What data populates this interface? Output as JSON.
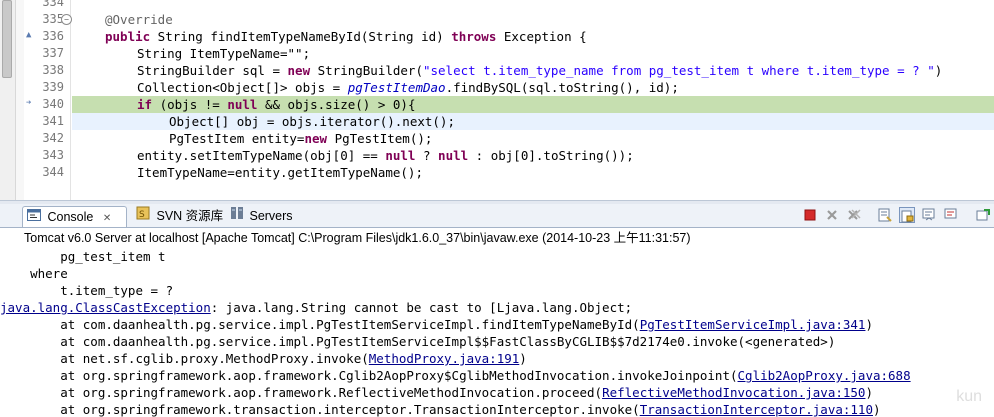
{
  "editor": {
    "gutter": {
      "line_numbers": [
        "334",
        "335",
        "336",
        "337",
        "338",
        "339",
        "340",
        "341",
        "342",
        "343",
        "344"
      ]
    },
    "lines": {
      "l335": "@Override",
      "l336": {
        "kw1": "public",
        "t1": " String findItemTypeNameById(String id) ",
        "kw2": "throws",
        "t2": " Exception {"
      },
      "l337": "String ItemTypeName=\"\";",
      "l338": {
        "t1": "StringBuilder sql = ",
        "kw": "new",
        "t2": " StringBuilder(",
        "str": "\"select t.item_type_name from pg_test_item t where t.item_type = ? \"",
        "t3": ")"
      },
      "l339": {
        "t1": "Collection<Object[]> objs = ",
        "fld": "pgTestItemDao",
        "t2": ".findBySQL(sql.toString(), id);"
      },
      "l340": {
        "kw": "if",
        "t1": " (objs != ",
        "kw2": "null",
        "t2": " && objs.size() > 0){"
      },
      "l341": "Object[] obj = objs.iterator().next();",
      "l342": {
        "t1": "PgTestItem entity=",
        "kw": "new",
        "t2": " PgTestItem();"
      },
      "l343": {
        "t1": "entity.setItemTypeName(obj[0] == ",
        "kw1": "null",
        "t2": " ? ",
        "kw2": "null",
        "t3": " : obj[0].toString());"
      },
      "l344": "ItemTypeName=entity.getItemTypeName();"
    }
  },
  "panel": {
    "tabs": {
      "console": "Console",
      "svn": "SVN 资源库",
      "servers": "Servers"
    },
    "close_glyph": "✕",
    "launch_title": "Tomcat v6.0 Server at localhost [Apache Tomcat] C:\\Program Files\\jdk1.6.0_37\\bin\\javaw.exe (2014-10-23 上午11:31:57)"
  },
  "console": {
    "l1": "        pg_test_item t",
    "l2": "    where",
    "l3": "        t.item_type = ?",
    "l4": {
      "exception": "java.lang.ClassCastException",
      "msg": ": java.lang.String cannot be cast to [Ljava.lang.Object;"
    },
    "l5": {
      "pre": "        at com.daanhealth.pg.service.impl.PgTestItemServiceImpl.findItemTypeNameById(",
      "link": "PgTestItemServiceImpl.java:341",
      "post": ")"
    },
    "l6": "        at com.daanhealth.pg.service.impl.PgTestItemServiceImpl$$FastClassByCGLIB$$7d2174e0.invoke(<generated>)",
    "l7": {
      "pre": "        at net.sf.cglib.proxy.MethodProxy.invoke(",
      "link": "MethodProxy.java:191",
      "post": ")"
    },
    "l8": {
      "pre": "        at org.springframework.aop.framework.Cglib2AopProxy$CglibMethodInvocation.invokeJoinpoint(",
      "link": "Cglib2AopProxy.java:688",
      "post": ""
    },
    "l9": {
      "pre": "        at org.springframework.aop.framework.ReflectiveMethodInvocation.proceed(",
      "link": "ReflectiveMethodInvocation.java:150",
      "post": ")"
    },
    "l10": {
      "pre": "        at org.springframework.transaction.interceptor.TransactionInterceptor.invoke(",
      "link": "TransactionInterceptor.java:110",
      "post": ")"
    }
  },
  "watermark": "kun",
  "colors": {
    "keyword": "#7f0055",
    "string": "#2a00ff",
    "field": "#0000c0",
    "annotation": "#646464",
    "current_line": "#c6dfb0",
    "link": "#00008b"
  }
}
